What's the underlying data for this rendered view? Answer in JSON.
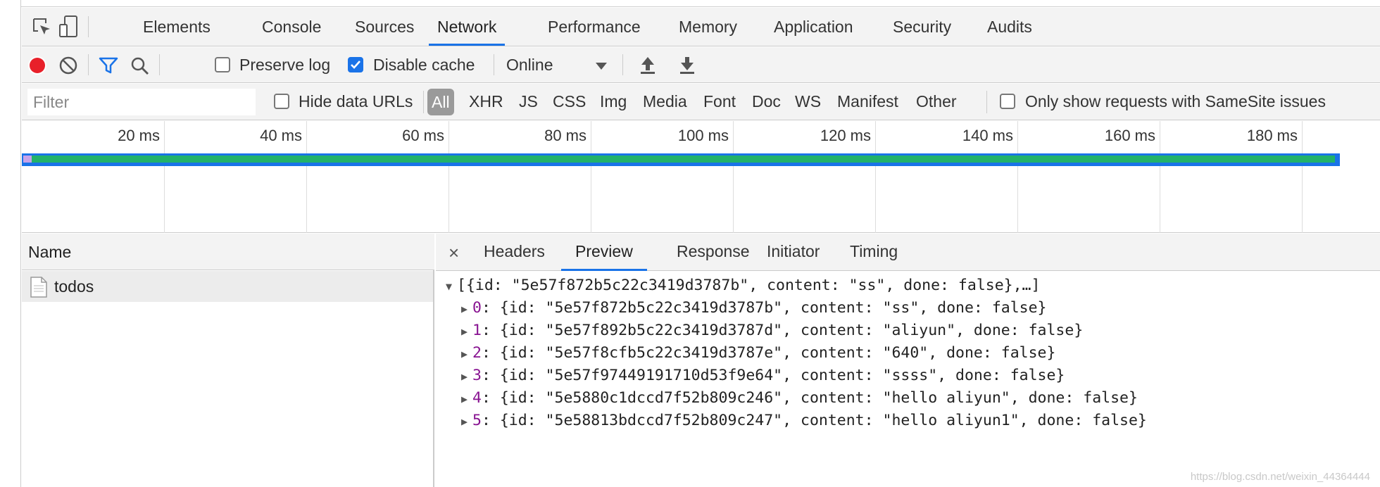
{
  "tabs": [
    "Elements",
    "Console",
    "Sources",
    "Network",
    "Performance",
    "Memory",
    "Application",
    "Security",
    "Audits"
  ],
  "active_tab": "Network",
  "toolbar": {
    "preserve_log_label": "Preserve log",
    "preserve_log_checked": false,
    "disable_cache_label": "Disable cache",
    "disable_cache_checked": true,
    "throttling_value": "Online"
  },
  "filter": {
    "placeholder": "Filter",
    "hide_data_urls_label": "Hide data URLs",
    "types": [
      "All",
      "XHR",
      "JS",
      "CSS",
      "Img",
      "Media",
      "Font",
      "Doc",
      "WS",
      "Manifest",
      "Other"
    ],
    "active_type": "All",
    "samesite_label": "Only show requests with SameSite issues"
  },
  "timeline": {
    "ticks": [
      "20 ms",
      "40 ms",
      "60 ms",
      "80 ms",
      "100 ms",
      "120 ms",
      "140 ms",
      "160 ms",
      "180 ms"
    ]
  },
  "requests": {
    "header": "Name",
    "rows": [
      "todos"
    ]
  },
  "detail": {
    "close_glyph": "×",
    "tabs": [
      "Headers",
      "Preview",
      "Response",
      "Initiator",
      "Timing"
    ],
    "active_tab": "Preview"
  },
  "preview": {
    "summary": "[{id: \"5e57f872b5c22c3419d3787b\", content: \"ss\", done: false},…]",
    "items": [
      {
        "index": "0",
        "value": "{id: \"5e57f872b5c22c3419d3787b\", content: \"ss\", done: false}"
      },
      {
        "index": "1",
        "value": "{id: \"5e57f892b5c22c3419d3787d\", content: \"aliyun\", done: false}"
      },
      {
        "index": "2",
        "value": "{id: \"5e57f8cfb5c22c3419d3787e\", content: \"640\", done: false}"
      },
      {
        "index": "3",
        "value": "{id: \"5e57f97449191710d53f9e64\", content: \"ssss\", done: false}"
      },
      {
        "index": "4",
        "value": "{id: \"5e5880c1dccd7f52b809c246\", content: \"hello aliyun\", done: false}"
      },
      {
        "index": "5",
        "value": "{id: \"5e58813bdccd7f52b809c247\", content: \"hello aliyun1\", done: false}"
      }
    ]
  },
  "watermark": "https://blog.csdn.net/weixin_44364444",
  "colors": {
    "accent": "#1a73e8",
    "record": "#e8202a",
    "bar_green": "#22b26a",
    "bar_blue": "#1a73e8",
    "json_key": "#881391"
  }
}
